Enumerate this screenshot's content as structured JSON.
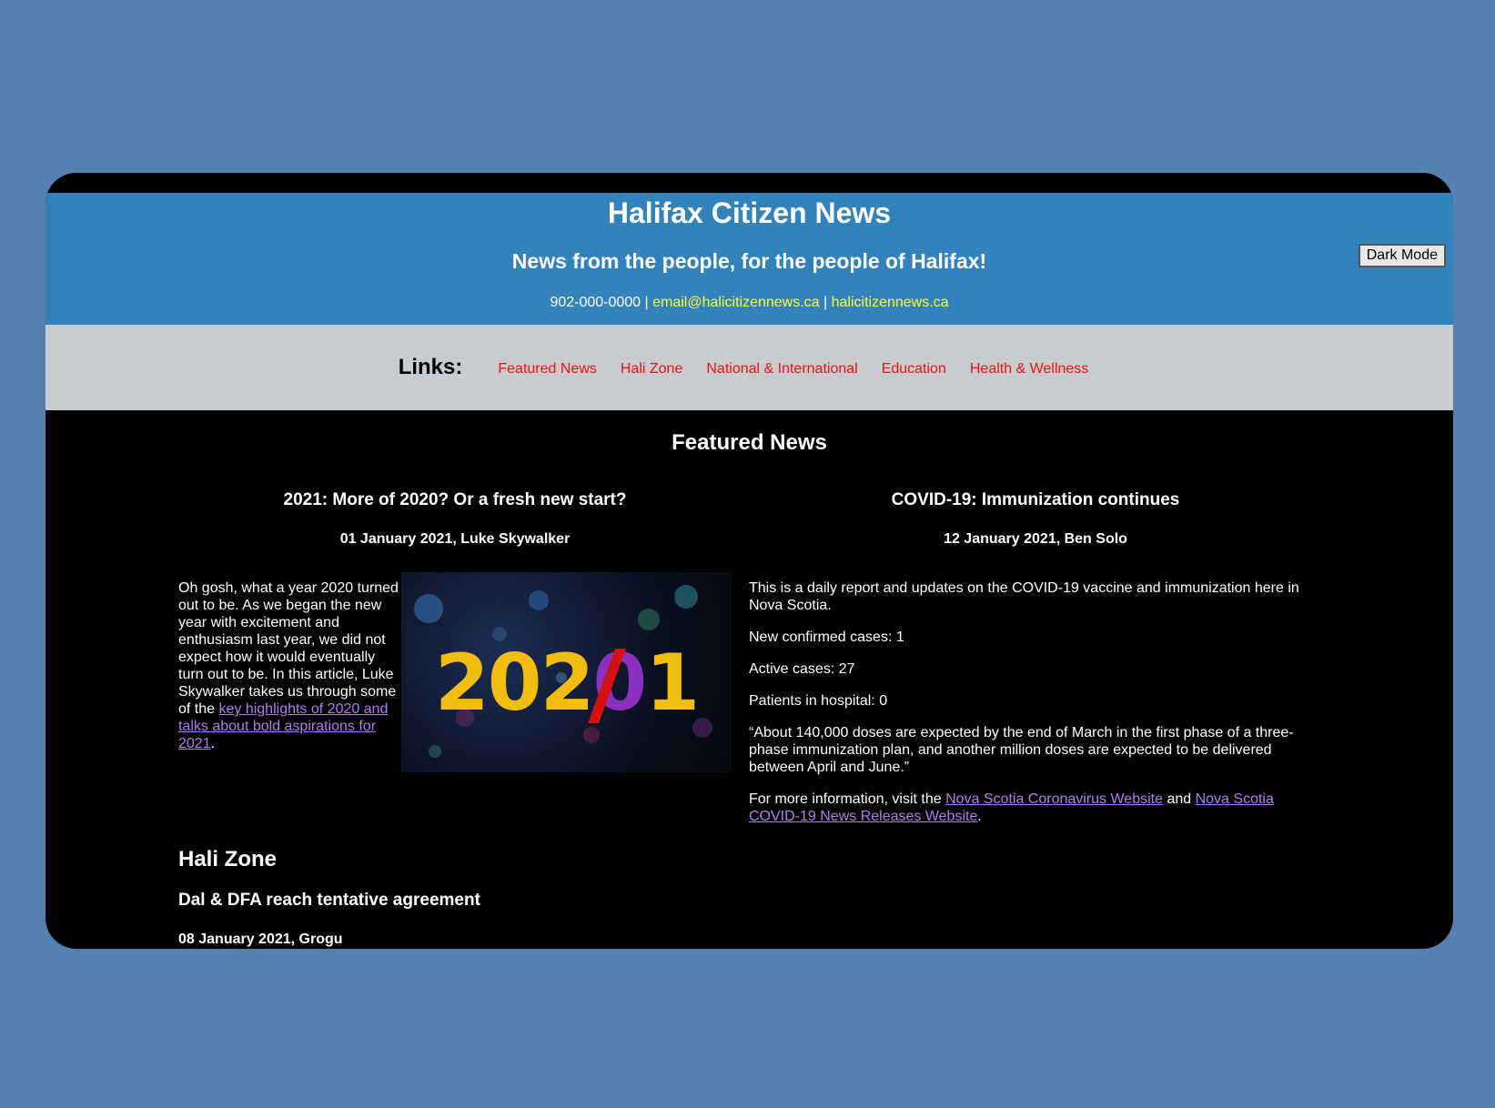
{
  "header": {
    "title": "Halifax Citizen News",
    "tagline": "News from the people, for the people of Halifax!",
    "phone": "902-000-0000",
    "sep": " | ",
    "email": "email@halicitizennews.ca",
    "site": "halicitizennews.ca",
    "dark_mode_label": "Dark Mode"
  },
  "nav": {
    "label": "Links:",
    "items": [
      "Featured News",
      "Hali Zone",
      "National & International",
      "Education",
      "Health & Wellness"
    ]
  },
  "featured": {
    "heading": "Featured News",
    "left": {
      "title": "2021: More of 2020? Or a fresh new start?",
      "byline": "01 January 2021, Luke Skywalker",
      "body_pre": "Oh gosh, what a year 2020 turned out to be. As we began the new year with excitement and enthusiasm last year, we did not expect how it would eventually turn out to be. In this article, Luke Skywalker takes us through some of the ",
      "link": "key highlights of 2020 and talks about bold aspirations for 2021",
      "body_post": ".",
      "image_text_a": "202",
      "image_text_b": "0",
      "image_text_c": "1"
    },
    "right": {
      "title": "COVID-19: Immunization continues",
      "byline": "12 January 2021, Ben Solo",
      "p1": "This is a daily report and updates on the COVID-19 vaccine and immunization here in Nova Scotia.",
      "p2": "New confirmed cases: 1",
      "p3": "Active cases: 27",
      "p4": "Patients in hospital: 0",
      "p5": "“About 140,000 doses are expected by the end of March in the first phase of a three-phase immunization plan, and another million doses are expected to be delivered between April and June.”",
      "p6_pre": "For more information, visit the ",
      "link1": "Nova Scotia Coronavirus Website",
      "p6_mid": " and ",
      "link2": "Nova Scotia COVID-19 News Releases Website",
      "p6_post": "."
    }
  },
  "hali_zone": {
    "heading": "Hali Zone",
    "title": "Dal & DFA reach tentative agreement",
    "byline": "08 January 2021, Grogu"
  },
  "colors": {
    "header_bg": "#3282bc",
    "nav_bg": "#c8ccce",
    "link_red": "#ee1111",
    "link_purple": "#b07cf0",
    "contact_yellow": "#ffff33"
  }
}
